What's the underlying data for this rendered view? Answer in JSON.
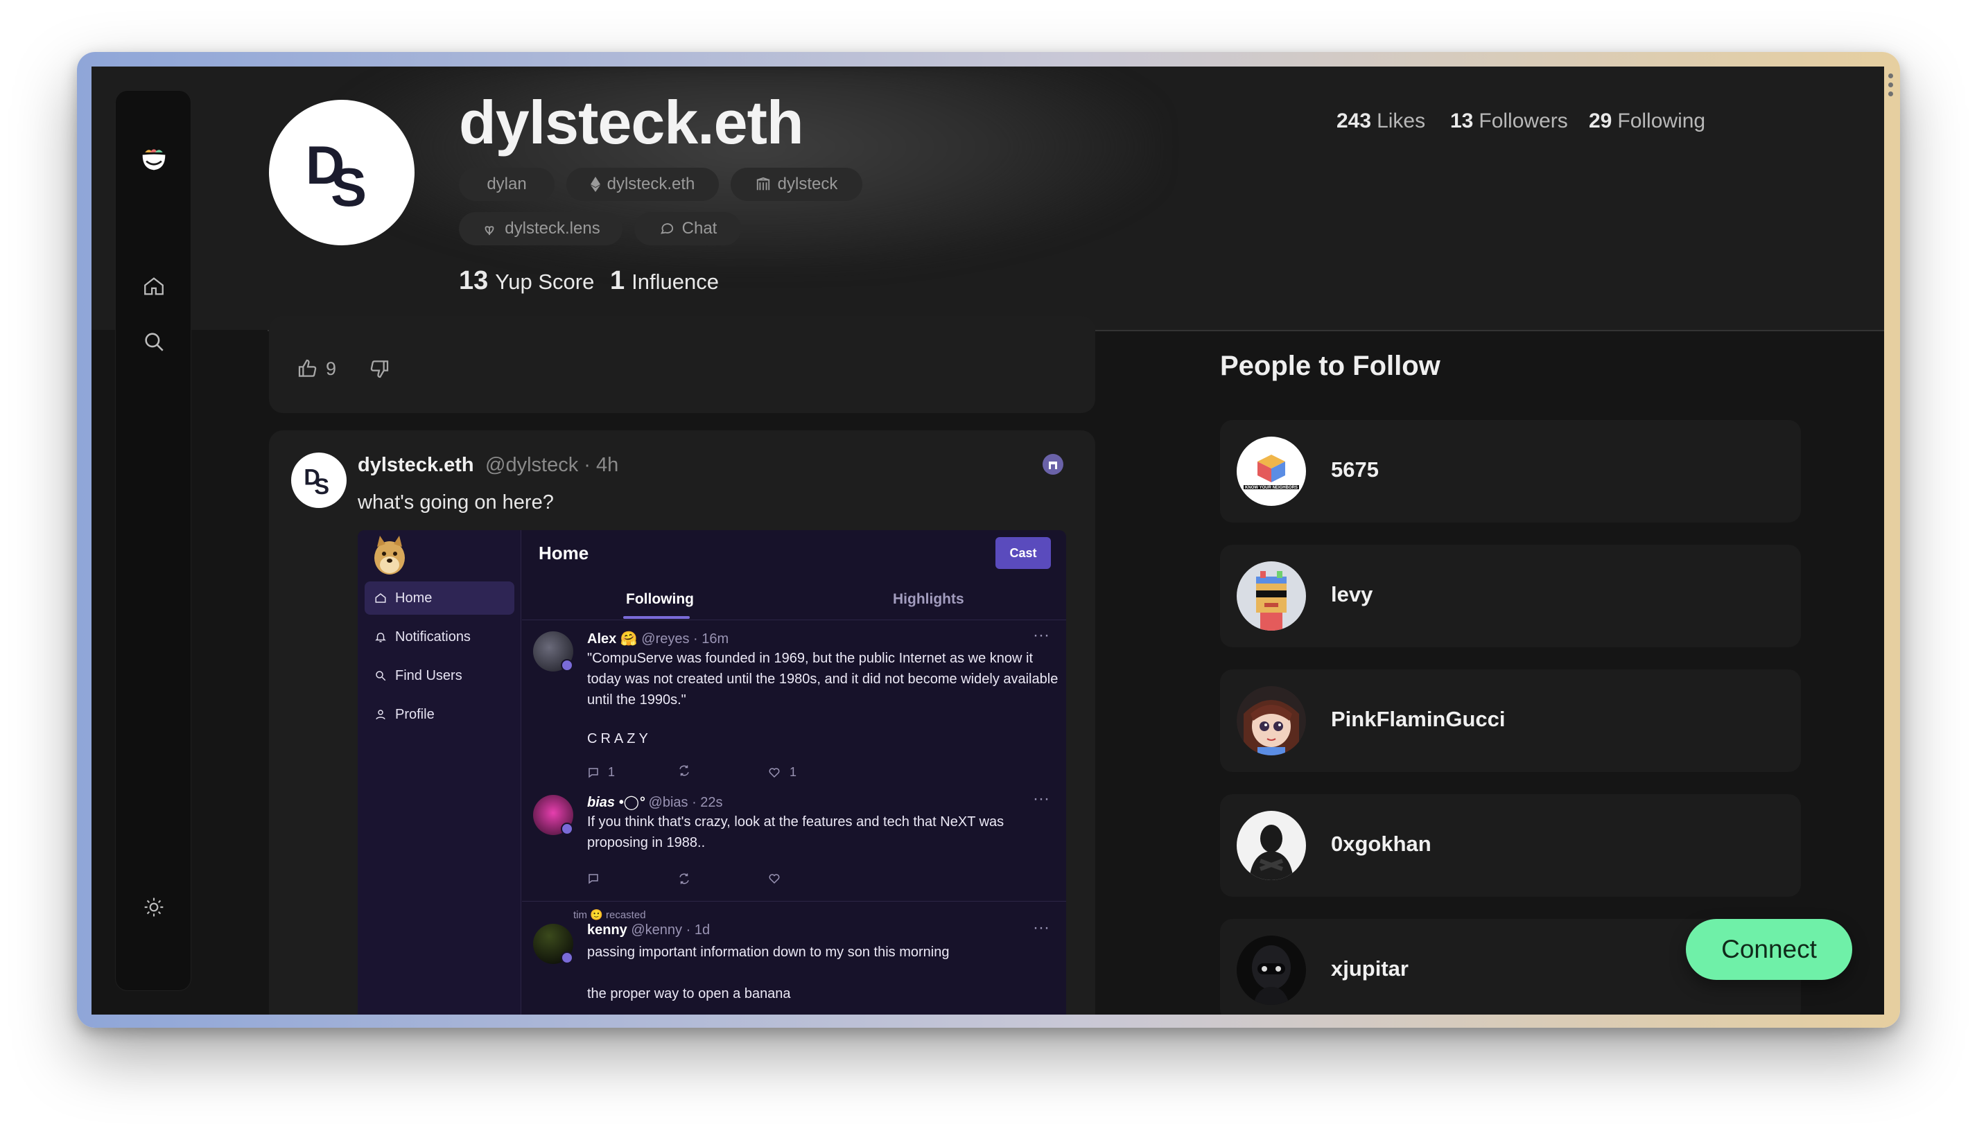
{
  "profile": {
    "name": "dylsteck.eth",
    "avatar_letters": "DS",
    "tags": [
      {
        "icon": "",
        "label": "dylan"
      },
      {
        "icon": "eth-icon",
        "label": "dylsteck.eth"
      },
      {
        "icon": "building-icon",
        "label": "dylsteck"
      },
      {
        "icon": "lens-icon",
        "label": "dylsteck.lens"
      },
      {
        "icon": "chat-icon",
        "label": "Chat"
      }
    ],
    "yup_score_value": "13",
    "yup_score_label": "Yup Score",
    "influence_value": "1",
    "influence_label": "Influence",
    "likes_value": "243",
    "likes_label": "Likes",
    "followers_value": "13",
    "followers_label": "Followers",
    "following_value": "29",
    "following_label": "Following"
  },
  "reactions": {
    "likes_count": "9"
  },
  "post": {
    "author": "dylsteck.eth",
    "meta": "@dylsteck · 4h",
    "text": "what's going on here?",
    "embedded": {
      "header_title": "Home",
      "cast_button": "Cast",
      "nav": [
        "Home",
        "Notifications",
        "Find Users",
        "Profile"
      ],
      "tabs": [
        "Following",
        "Highlights"
      ],
      "tweets": [
        {
          "name": "Alex 🤗",
          "handle": "@reyes · 16m",
          "body": "\"CompuServe was founded in 1969, but the public Internet as we know it today was not created until the 1980s, and it did not become widely available until the 1990s.\"",
          "extra": "CRAZY",
          "replies": "1",
          "likes": "1"
        },
        {
          "name": "bias •◯°",
          "handle": "@bias · 22s",
          "body": "If you think that's crazy, look at the features and tech that NeXT was proposing in 1988..",
          "replies": "",
          "likes": ""
        },
        {
          "recast_label": "tim 🙂 recasted",
          "name": "kenny",
          "handle": "@kenny · 1d",
          "body": "passing important information down to my son this morning",
          "extra": "the proper way to open a banana"
        }
      ]
    }
  },
  "people_to_follow": {
    "title": "People to Follow",
    "people": [
      "5675",
      "levy",
      "PinkFlaminGucci",
      "0xgokhan",
      "xjupitar"
    ],
    "avatar_caption": "KNOW YOUR NEIGHBORS"
  },
  "connect_button": "Connect",
  "colors": {
    "accent_green": "#6ff0a8",
    "background": "#151515",
    "card": "#1e1e1e",
    "embed_purple": "#17122a"
  }
}
